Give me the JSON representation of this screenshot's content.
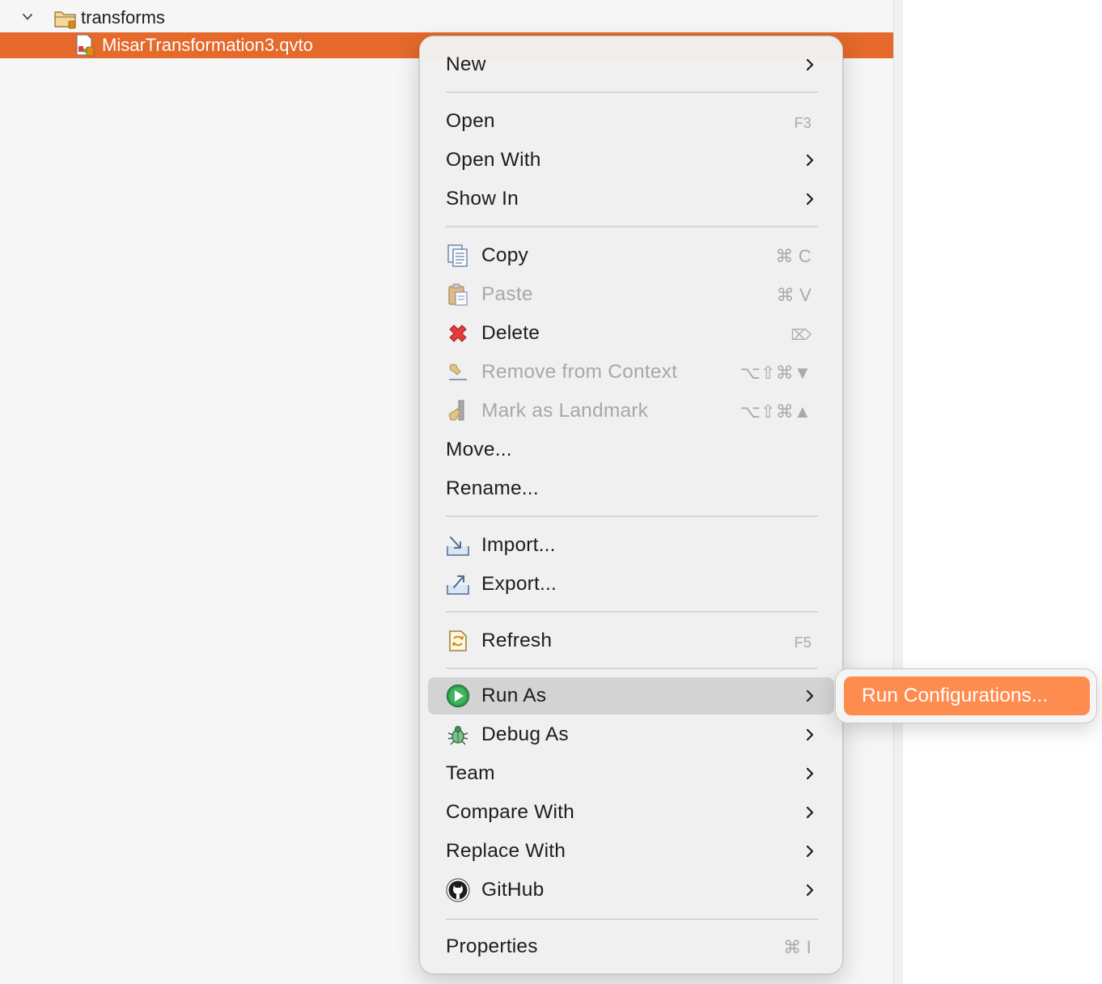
{
  "tree": {
    "folder_name": "transforms",
    "file_name": "MisarTransformation3.qvto"
  },
  "menu": {
    "new": {
      "label": "New"
    },
    "open": {
      "label": "Open",
      "shortcut": "F3"
    },
    "open_with": {
      "label": "Open With"
    },
    "show_in": {
      "label": "Show In"
    },
    "copy": {
      "label": "Copy",
      "shortcut": "⌘ C"
    },
    "paste": {
      "label": "Paste",
      "shortcut": "⌘ V"
    },
    "delete": {
      "label": "Delete",
      "shortcut": "⌦"
    },
    "remove_from_context": {
      "label": "Remove from Context",
      "shortcut": "⌥⇧⌘▼"
    },
    "mark_as_landmark": {
      "label": "Mark as Landmark",
      "shortcut": "⌥⇧⌘▲"
    },
    "move": {
      "label": "Move..."
    },
    "rename": {
      "label": "Rename..."
    },
    "import": {
      "label": "Import..."
    },
    "export": {
      "label": "Export..."
    },
    "refresh": {
      "label": "Refresh",
      "shortcut": "F5"
    },
    "run_as": {
      "label": "Run As"
    },
    "debug_as": {
      "label": "Debug As"
    },
    "team": {
      "label": "Team"
    },
    "compare_with": {
      "label": "Compare With"
    },
    "replace_with": {
      "label": "Replace With"
    },
    "github": {
      "label": "GitHub"
    },
    "properties": {
      "label": "Properties",
      "shortcut": "⌘ I"
    }
  },
  "submenu": {
    "run_configurations": {
      "label": "Run Configurations..."
    }
  },
  "colors": {
    "selection": "#e4692a",
    "submenu_highlight": "#ff8c4f",
    "menu_highlight": "#d3d3d3"
  },
  "icons": {
    "twisty": "chevron-down-icon",
    "folder": "folder-icon",
    "file": "qvto-file-icon",
    "copy": "copy-icon",
    "paste": "paste-icon",
    "delete": "delete-x-icon",
    "remove": "remove-context-icon",
    "landmark": "landmark-icon",
    "import": "import-icon",
    "export": "export-icon",
    "refresh": "refresh-icon",
    "run": "run-icon",
    "debug": "bug-icon",
    "github": "github-icon",
    "submenu": "chevron-right-icon"
  }
}
